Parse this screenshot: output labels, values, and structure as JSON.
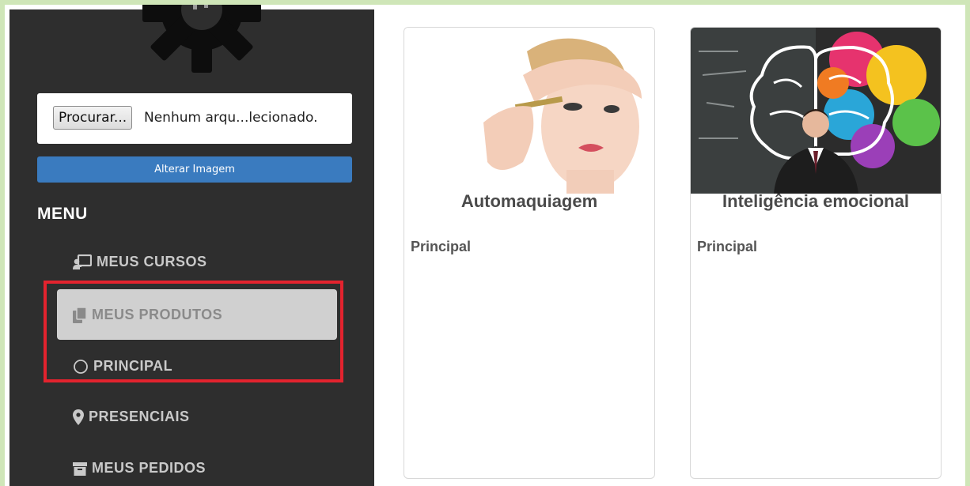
{
  "sidebar": {
    "file_input": {
      "button_label": "Procurar...",
      "file_status": "Nenhum arqu...lecionado."
    },
    "change_image_label": "Alterar Imagem",
    "menu_title": "MENU",
    "items": [
      {
        "label": "MEUS CURSOS",
        "icon": "chalkboard-teacher-icon"
      },
      {
        "label": "MEUS PRODUTOS",
        "icon": "copy-icon",
        "active": true
      },
      {
        "label": "PRINCIPAL",
        "icon": "circle-outline-icon"
      },
      {
        "label": "PRESENCIAIS",
        "icon": "map-marker-icon"
      },
      {
        "label": "MEUS PEDIDOS",
        "icon": "archive-icon"
      }
    ]
  },
  "products": [
    {
      "title": "Automaquiagem",
      "category": "Principal"
    },
    {
      "title": "Inteligência emocional",
      "category": "Principal"
    }
  ],
  "colors": {
    "sidebar_bg": "#2e2e2e",
    "button_blue": "#3a7bbf",
    "active_item_bg": "#d0d0d0",
    "highlight_red": "#e3232e",
    "frame_green": "#cfe6b8"
  }
}
